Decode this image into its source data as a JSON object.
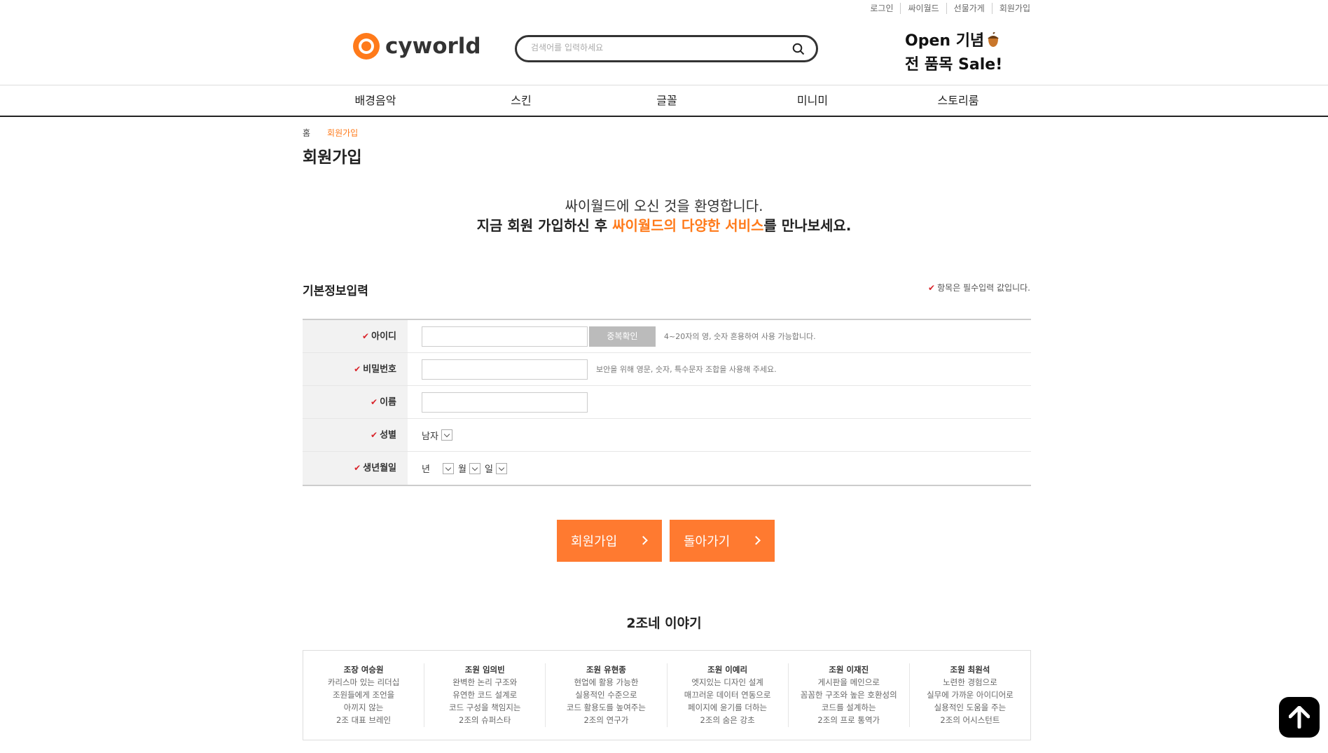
{
  "util_links": [
    "로그인",
    "싸이월드",
    "선물가게",
    "회원가입"
  ],
  "header": {
    "logo_text": "cyworld",
    "search_placeholder": "검색어를 입력하세요",
    "promo_line1": "Open 기념",
    "promo_line2": "전 품목 Sale!"
  },
  "gnb": [
    "배경음악",
    "스킨",
    "글꼴",
    "미니미",
    "스토리룸"
  ],
  "breadcrumb": {
    "home": "홈",
    "current": "회원가입"
  },
  "page_title": "회원가입",
  "welcome": {
    "line1": "싸이월드에 오신 것을 환영합니다.",
    "line2_prefix": "지금 회원 가입하신 후 ",
    "line2_highlight": "싸이월드의 다양한 서비스",
    "line2_suffix": "를 만나보세요."
  },
  "form": {
    "section_title": "기본정보입력",
    "required_note": "항목은 필수입력 값입니다.",
    "id_label": "아이디",
    "dup_check": "중복확인",
    "id_hint": "4~20자의 영, 숫자 혼용하여 사용 가능합니다.",
    "pw_label": "비밀번호",
    "pw_hint": "보안을 위해 영문, 숫자, 특수문자 조합을 사용해 주세요.",
    "name_label": "이름",
    "gender_label": "성별",
    "gender_value": "남자",
    "birth_label": "생년월일",
    "year": "년",
    "month": "월",
    "day": "일"
  },
  "buttons": {
    "join": "회원가입",
    "back": "돌아가기"
  },
  "team": {
    "title": "2조네 이야기",
    "members": [
      {
        "name": "조장 여승원",
        "desc": [
          "카리스마 있는 리더십",
          "조원들에게 조언을",
          "아끼지 않는",
          "2조 대표 브레인"
        ]
      },
      {
        "name": "조원 임의빈",
        "desc": [
          "완벽한 논리 구조와",
          "유연한 코드 설계로",
          "코드 구성을 책임지는",
          "2조의 슈퍼스타"
        ]
      },
      {
        "name": "조원 유현종",
        "desc": [
          "현업에 활용 가능한",
          "실용적인 수준으로",
          "코드 활용도를 높여주는",
          "2조의 연구가"
        ]
      },
      {
        "name": "조원 이예리",
        "desc": [
          "엣지있는 디자인 설계",
          "매끄러운 데이터 연동으로",
          "페이지에 윤기를 더하는",
          "2조의 숨은 강초"
        ]
      },
      {
        "name": "조원 이재진",
        "desc": [
          "게시판을 메인으로",
          "꼼꼼한 구조와 높은 호환성의",
          "코드를 설계하는",
          "2조의 프로 통역가"
        ]
      },
      {
        "name": "조원 최원석",
        "desc": [
          "노련한 경험으로",
          "실무에 가까운 아이디어로",
          "실용적인 도움을 주는",
          "2조의 어시스턴트"
        ]
      }
    ]
  },
  "colors": {
    "accent": "#ff7a30",
    "check": "#d9242b"
  }
}
